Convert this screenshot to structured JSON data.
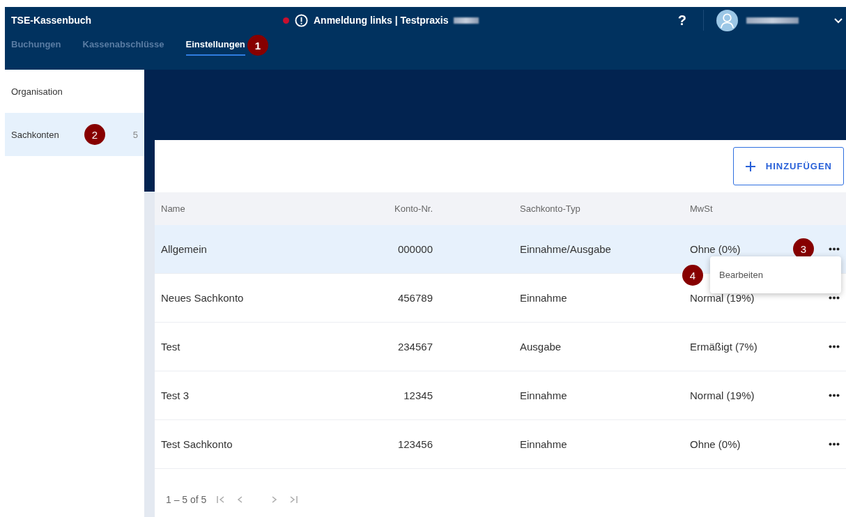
{
  "app_title": "TSE-Kassenbuch",
  "status": {
    "alert": true,
    "text": "Anmeldung links | Testpraxis"
  },
  "help": "?",
  "tabs": [
    {
      "label": "Buchungen",
      "selected": false
    },
    {
      "label": "Kassenabschlüsse",
      "selected": false
    },
    {
      "label": "Einstellungen",
      "selected": true,
      "callout": "1"
    }
  ],
  "sidebar": {
    "items": [
      {
        "label": "Organisation",
        "selected": false
      },
      {
        "label": "Sachkonten",
        "selected": true,
        "count": "5",
        "callout": "2"
      }
    ]
  },
  "add_button": "HINZUFÜGEN",
  "table": {
    "columns": [
      "Name",
      "Konto-Nr.",
      "Sachkonto-Typ",
      "MwSt"
    ],
    "rows": [
      {
        "name": "Allgemein",
        "number": "000000",
        "type": "Einnahme/Ausgabe",
        "vat": "Ohne (0%)",
        "selected": true
      },
      {
        "name": "Neues Sachkonto",
        "number": "456789",
        "type": "Einnahme",
        "vat": "Normal (19%)",
        "selected": false
      },
      {
        "name": "Test",
        "number": "234567",
        "type": "Ausgabe",
        "vat": "Ermäßigt (7%)",
        "selected": false
      },
      {
        "name": "Test 3",
        "number": "12345",
        "type": "Einnahme",
        "vat": "Normal (19%)",
        "selected": false
      },
      {
        "name": "Test Sachkonto",
        "number": "123456",
        "type": "Einnahme",
        "vat": "Ohne (0%)",
        "selected": false
      }
    ]
  },
  "row_menu": {
    "callout": "3",
    "items": [
      {
        "label": "Bearbeiten",
        "callout": "4"
      }
    ]
  },
  "pagination": {
    "range": "1 – 5 of 5"
  }
}
